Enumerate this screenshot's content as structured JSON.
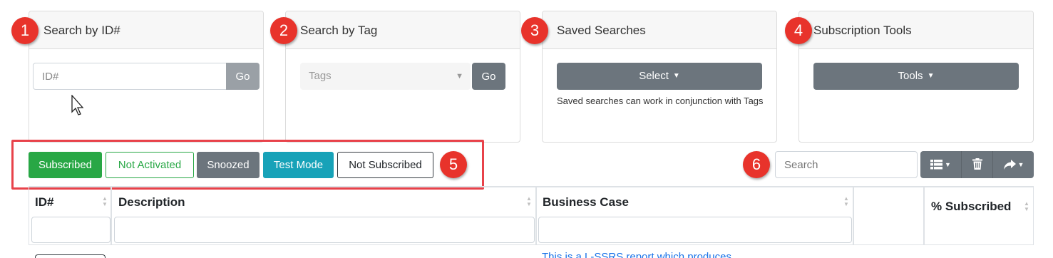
{
  "cards": {
    "id_search": {
      "number": "1",
      "title": "Search by ID#",
      "placeholder": "ID#",
      "go": "Go"
    },
    "tag_search": {
      "number": "2",
      "title": "Search by Tag",
      "placeholder": "Tags",
      "go": "Go"
    },
    "saved": {
      "number": "3",
      "title": "Saved Searches",
      "button": "Select",
      "note": "Saved searches can work in conjunction with Tags"
    },
    "tools": {
      "number": "4",
      "title": "Subscription Tools",
      "button": "Tools"
    }
  },
  "status_filters": {
    "number": "5",
    "subscribed": "Subscribed",
    "not_activated": "Not Activated",
    "snoozed": "Snoozed",
    "test_mode": "Test Mode",
    "not_subscribed": "Not Subscribed"
  },
  "table_toolbar": {
    "number": "6",
    "search_placeholder": "Search"
  },
  "table": {
    "columns": [
      "ID#",
      "Description",
      "Business Case",
      "",
      "% Subscribed"
    ],
    "first_row_partial": "This is a L-SSRS report which produces ..."
  },
  "colors": {
    "badge": "#e8332b",
    "success": "#28a745",
    "secondary": "#6c757d",
    "info": "#17a2b8",
    "highlight_box": "#e8424a",
    "link": "#1a73e8"
  }
}
